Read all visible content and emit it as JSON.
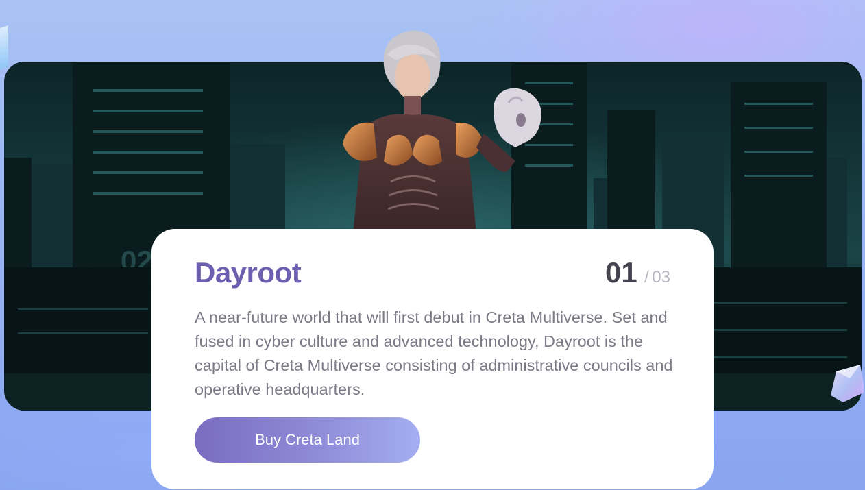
{
  "card": {
    "title": "Dayroot",
    "counter_current": "01",
    "counter_separator": "/",
    "counter_total": "03",
    "description": "A near-future world that will first debut in Creta Multiverse. Set and fused in cyber culture and advanced technology, Dayroot is the capital of Creta Multiverse consisting of administrative councils and operative headquarters.",
    "button_label": "Buy Creta Land"
  },
  "colors": {
    "title": "#6c5fb0",
    "counter": "#444450",
    "description": "#7b7b87",
    "button_start": "#7a6cc0",
    "button_end": "#a4aef0",
    "background": "#9ab4f3"
  },
  "icons": {
    "banner": "cyberpunk-city-illustration",
    "character": "cyborg-character-illustration",
    "decor_right": "crystal-cube-icon",
    "decor_left": "crystal-shard-icon"
  }
}
